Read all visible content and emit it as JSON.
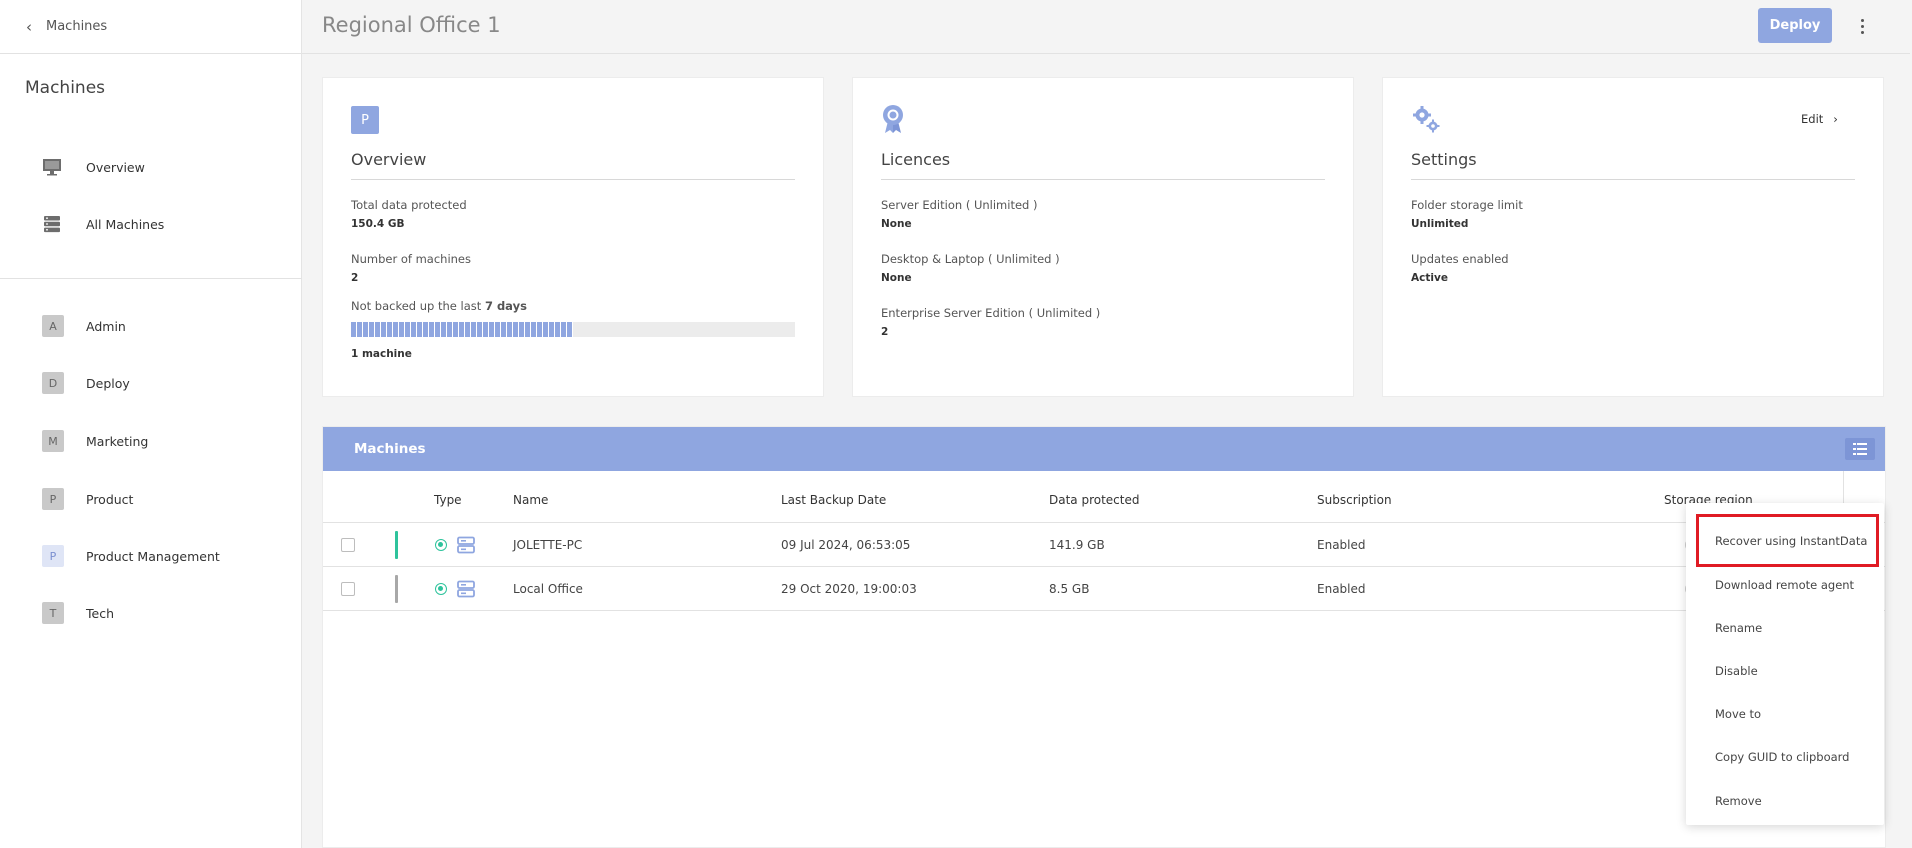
{
  "sidebar": {
    "back_label": "Machines",
    "title": "Machines",
    "nav": [
      {
        "label": "Overview",
        "icon": "monitor-icon"
      },
      {
        "label": "All Machines",
        "icon": "server-stack-icon"
      }
    ],
    "groups": [
      {
        "letter": "A",
        "label": "Admin"
      },
      {
        "letter": "D",
        "label": "Deploy"
      },
      {
        "letter": "M",
        "label": "Marketing"
      },
      {
        "letter": "P",
        "label": "Product"
      },
      {
        "letter": "P",
        "label": "Product Management"
      },
      {
        "letter": "T",
        "label": "Tech"
      }
    ]
  },
  "header": {
    "title": "Regional Office 1",
    "deploy_label": "Deploy"
  },
  "overview_card": {
    "badge": "P",
    "title": "Overview",
    "total_label": "Total data protected",
    "total_value": "150.4 GB",
    "machines_label": "Number of machines",
    "machines_value": "2",
    "not_backed_prefix": "Not backed up the last ",
    "not_backed_days": "7 days",
    "not_backed_fraction": 0.5,
    "not_backed_value": "1 machine"
  },
  "licences_card": {
    "title": "Licences",
    "items": [
      {
        "label": "Server Edition ( Unlimited )",
        "value": "None"
      },
      {
        "label": "Desktop & Laptop ( Unlimited )",
        "value": "None"
      },
      {
        "label": "Enterprise Server Edition ( Unlimited )",
        "value": "2"
      }
    ]
  },
  "settings_card": {
    "title": "Settings",
    "edit_label": "Edit",
    "items": [
      {
        "label": "Folder storage limit",
        "value": "Unlimited"
      },
      {
        "label": "Updates enabled",
        "value": "Active"
      }
    ]
  },
  "machines_panel": {
    "title": "Machines",
    "columns": [
      "Type",
      "Name",
      "Last Backup Date",
      "Data protected",
      "Subscription",
      "Storage region"
    ],
    "rows": [
      {
        "name": "JOLETTE-PC",
        "last_backup": "09 Jul 2024, 06:53:05",
        "data_protected": "141.9 GB",
        "subscription": "Enabled",
        "status_color": "#2ec39c"
      },
      {
        "name": "Local Office",
        "last_backup": "29 Oct 2020, 19:00:03",
        "data_protected": "8.5 GB",
        "subscription": "Enabled",
        "status_color": "#a8a8a8"
      }
    ]
  },
  "context_menu": {
    "items": [
      "Recover using InstantData",
      "Download remote agent",
      "Rename",
      "Disable",
      "Move to",
      "Copy GUID to clipboard",
      "Remove"
    ],
    "highlighted_index": 0,
    "highlight_color": "#e01b24"
  },
  "colors": {
    "accent": "#8fa6e0",
    "online": "#2ec39c"
  }
}
